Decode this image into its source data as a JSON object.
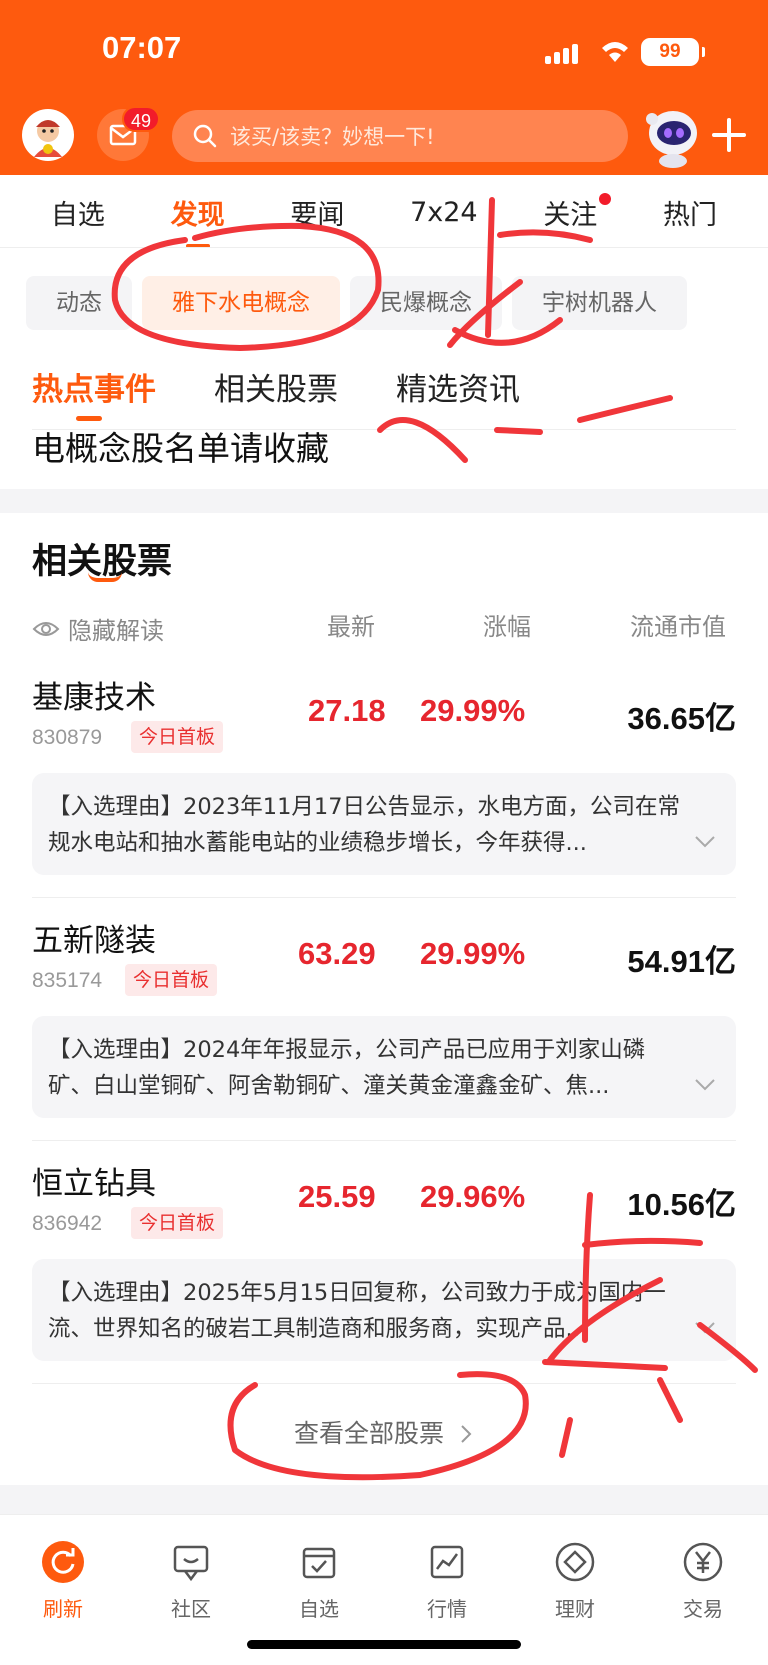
{
  "status_bar": {
    "time": "07:07",
    "battery": "99"
  },
  "header": {
    "mail_badge": "49",
    "search_placeholder": "该买/该卖？妙想一下!"
  },
  "top_nav": [
    "自选",
    "发现",
    "要闻",
    "7x24",
    "关注",
    "热门"
  ],
  "top_nav_active": "发现",
  "chips": [
    "动态",
    "雅下水电概念",
    "民爆概念",
    "宇树机器人"
  ],
  "chip_active": "雅下水电概念",
  "sub_tabs": [
    "热点事件",
    "相关股票",
    "精选资讯"
  ],
  "sub_tab_active": "热点事件",
  "news_title": "电概念股名单请收藏",
  "section": {
    "title": "相关股票",
    "hide_label": "隐藏解读",
    "columns": [
      "最新",
      "涨幅",
      "流通市值"
    ]
  },
  "stocks": [
    {
      "name": "基康技术",
      "code": "830879",
      "tag": "今日首板",
      "price": "27.18",
      "change": "29.99%",
      "cap": "36.65亿",
      "reason": "【入选理由】2023年11月17日公告显示，水电方面，公司在常规水电站和抽水蓄能电站的业绩稳步增长，今年获得..."
    },
    {
      "name": "五新隧装",
      "code": "835174",
      "tag": "今日首板",
      "price": "63.29",
      "change": "29.99%",
      "cap": "54.91亿",
      "reason": "【入选理由】2024年年报显示，公司产品已应用于刘家山磷矿、白山堂铜矿、阿舍勒铜矿、潼关黄金潼鑫金矿、焦..."
    },
    {
      "name": "恒立钻具",
      "code": "836942",
      "tag": "今日首板",
      "price": "25.59",
      "change": "29.96%",
      "cap": "10.56亿",
      "reason": "【入选理由】2025年5月15日回复称，公司致力于成为国内一流、世界知名的破岩工具制造商和服务商，实现产品..."
    }
  ],
  "view_all": "查看全部股票",
  "bottom_nav": [
    "刷新",
    "社区",
    "自选",
    "行情",
    "理财",
    "交易"
  ],
  "colors": {
    "brand": "#fe5a0e",
    "up": "#e6262e",
    "annotation": "#f0363a"
  }
}
